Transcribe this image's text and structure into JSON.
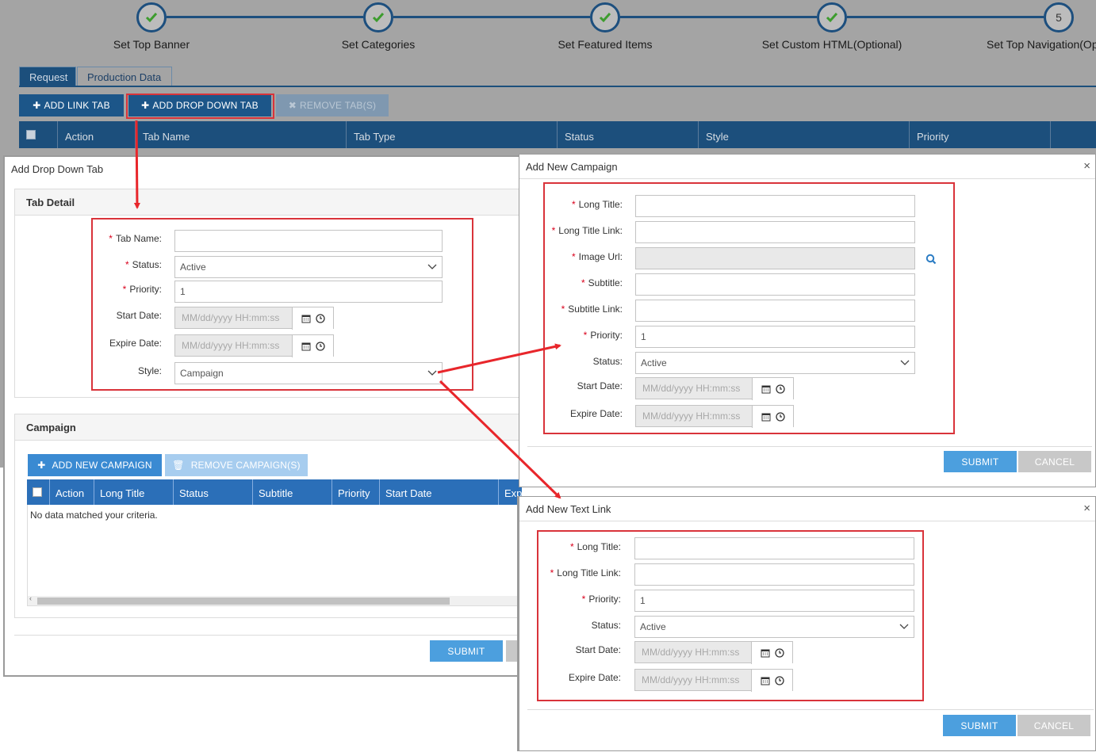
{
  "wizard": {
    "steps": [
      {
        "label": "Set Top Banner",
        "state": "done"
      },
      {
        "label": "Set Categories",
        "state": "done"
      },
      {
        "label": "Set Featured Items",
        "state": "done"
      },
      {
        "label": "Set Custom HTML(Optional)",
        "state": "done"
      },
      {
        "label": "Set Top Navigation(Op",
        "state": "current",
        "number": "5"
      }
    ]
  },
  "bg_tabs": [
    "Request",
    "Production Data"
  ],
  "bg_toolbar": {
    "add_link": "ADD LINK TAB",
    "add_dropdown": "ADD DROP DOWN TAB",
    "remove": "REMOVE TAB(S)"
  },
  "bg_table_headers": [
    "Action",
    "Tab Name",
    "Tab Type",
    "Status",
    "Style",
    "Priority"
  ],
  "dropdown_modal": {
    "title": "Add Drop Down Tab",
    "tab_detail": "Tab Detail",
    "fields": {
      "tab_name_label": "Tab Name:",
      "status_label": "Status:",
      "status_value": "Active",
      "priority_label": "Priority:",
      "priority_value": "1",
      "start_date_label": "Start Date:",
      "expire_date_label": "Expire Date:",
      "date_placeholder": "MM/dd/yyyy HH:mm:ss",
      "style_label": "Style:",
      "style_value": "Campaign"
    },
    "campaign_section": "Campaign",
    "add_campaign": "ADD NEW CAMPAIGN",
    "remove_campaign": "REMOVE CAMPAIGN(S)",
    "table_headers": [
      "Action",
      "Long Title",
      "Status",
      "Subtitle",
      "Priority",
      "Start Date",
      "Expire Da"
    ],
    "empty_text": "No data matched your criteria.",
    "submit": "SUBMIT"
  },
  "campaign_modal": {
    "title": "Add New Campaign",
    "close": "×",
    "labels": {
      "long_title": "Long Title:",
      "long_title_link": "Long Title Link:",
      "image_url": "Image Url:",
      "subtitle": "Subtitle:",
      "subtitle_link": "Subtitle Link:",
      "priority": "Priority:",
      "status": "Status:",
      "start_date": "Start Date:",
      "expire_date": "Expire Date:"
    },
    "priority_value": "1",
    "status_value": "Active",
    "date_placeholder": "MM/dd/yyyy HH:mm:ss",
    "submit": "SUBMIT",
    "cancel": "CANCEL"
  },
  "textlink_modal": {
    "title": "Add New Text Link",
    "close": "×",
    "labels": {
      "long_title": "Long Title:",
      "long_title_link": "Long Title Link:",
      "priority": "Priority:",
      "status": "Status:",
      "start_date": "Start Date:",
      "expire_date": "Expire Date:"
    },
    "priority_value": "1",
    "status_value": "Active",
    "date_placeholder": "MM/dd/yyyy HH:mm:ss",
    "submit": "SUBMIT",
    "cancel": "CANCEL"
  },
  "colors": {
    "accent": "#4c9fde",
    "table_header": "#2b6fb8",
    "highlight": "#d9333a",
    "required": "#d9001b"
  }
}
